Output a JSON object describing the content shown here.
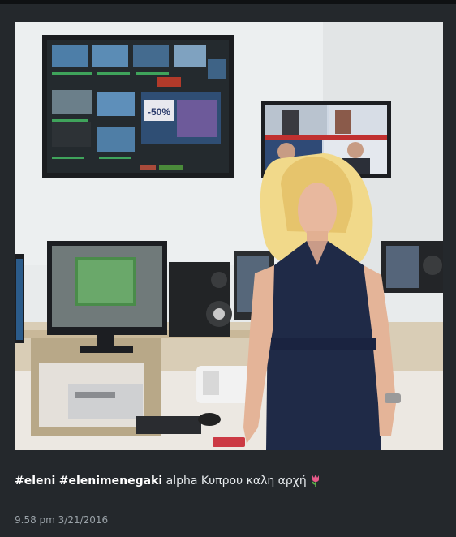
{
  "post": {
    "hashtags": [
      "#eleni",
      "#elenimenegaki"
    ],
    "caption_text": "alpha Κυπρου καλη αρχή",
    "emoji": "tulip-icon",
    "timestamp": "9.58 pm 3/21/2016"
  },
  "photo": {
    "monitor_badge": "-50%"
  },
  "colors": {
    "background": "#24282c",
    "caption_text": "#e7ebee",
    "timestamp": "#9aa2a8"
  }
}
